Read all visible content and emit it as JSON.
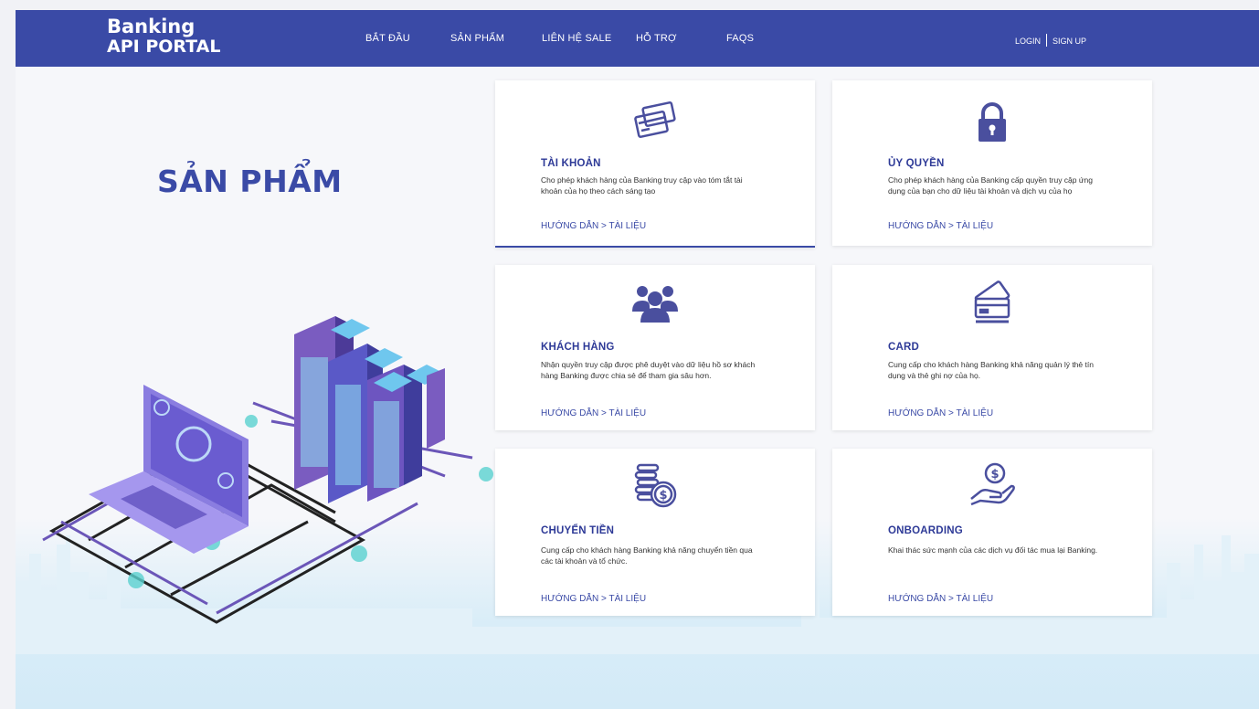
{
  "header": {
    "brand_line1": "Banking",
    "brand_line2": "API PORTAL",
    "nav": [
      "BẮT ĐẦU",
      "SẢN PHẨM",
      "LIÊN HỆ SALE",
      "HỖ TRỢ",
      "FAQS"
    ],
    "login": "LOGIN",
    "signup": "SIGN UP"
  },
  "heading": "SẢN PHẨM",
  "cards": [
    {
      "title": "TÀI KHOẢN",
      "desc": "Cho phép khách hàng của Banking truy cập vào tóm tắt tài khoản của họ theo cách sáng tạo",
      "guide": "HƯỚNG DẪN",
      "arrow": ">",
      "docs": "TÀI LIỆU",
      "icon": "credit-cards-icon"
    },
    {
      "title": "ỦY QUYỀN",
      "desc": "Cho phép khách hàng của Banking cấp quyền truy cập ứng dụng của bạn cho dữ liệu tài khoản và dịch vụ của họ",
      "guide": "HƯỚNG DẪN",
      "arrow": ">",
      "docs": "TÀI LIỆU",
      "icon": "lock-icon"
    },
    {
      "title": "KHÁCH HÀNG",
      "desc": "Nhận quyền truy cập được phê duyệt vào dữ liệu hồ sơ khách hàng Banking được chia sẻ để tham gia sâu hơn.",
      "guide": "HƯỚNG DẪN",
      "arrow": ">",
      "docs": "TÀI LIỆU",
      "icon": "users-icon"
    },
    {
      "title": "CARD",
      "desc": "Cung cấp cho khách hàng Banking khả năng quản lý thẻ tín dụng và thẻ ghi nợ của họ.",
      "guide": "HƯỚNG DẪN",
      "arrow": ">",
      "docs": "TÀI LIỆU",
      "icon": "card-icon"
    },
    {
      "title": "CHUYỂN TIỀN",
      "desc": "Cung cấp cho khách hàng Banking khả năng chuyển tiền qua các tài khoản và tổ chức.",
      "guide": "HƯỚNG DẪN",
      "arrow": ">",
      "docs": "TÀI LIỆU",
      "icon": "coins-icon"
    },
    {
      "title": "ONBOARDING",
      "desc": "Khai thác sức mạnh của các dịch vụ đối tác mua lại Banking.",
      "guide": "HƯỚNG DẪN",
      "arrow": ">",
      "docs": "TÀI LIỆU",
      "icon": "hand-money-icon"
    }
  ],
  "colors": {
    "primary": "#3a4aa6",
    "icon": "#4a4f9e",
    "sky": "#d9edf8"
  }
}
